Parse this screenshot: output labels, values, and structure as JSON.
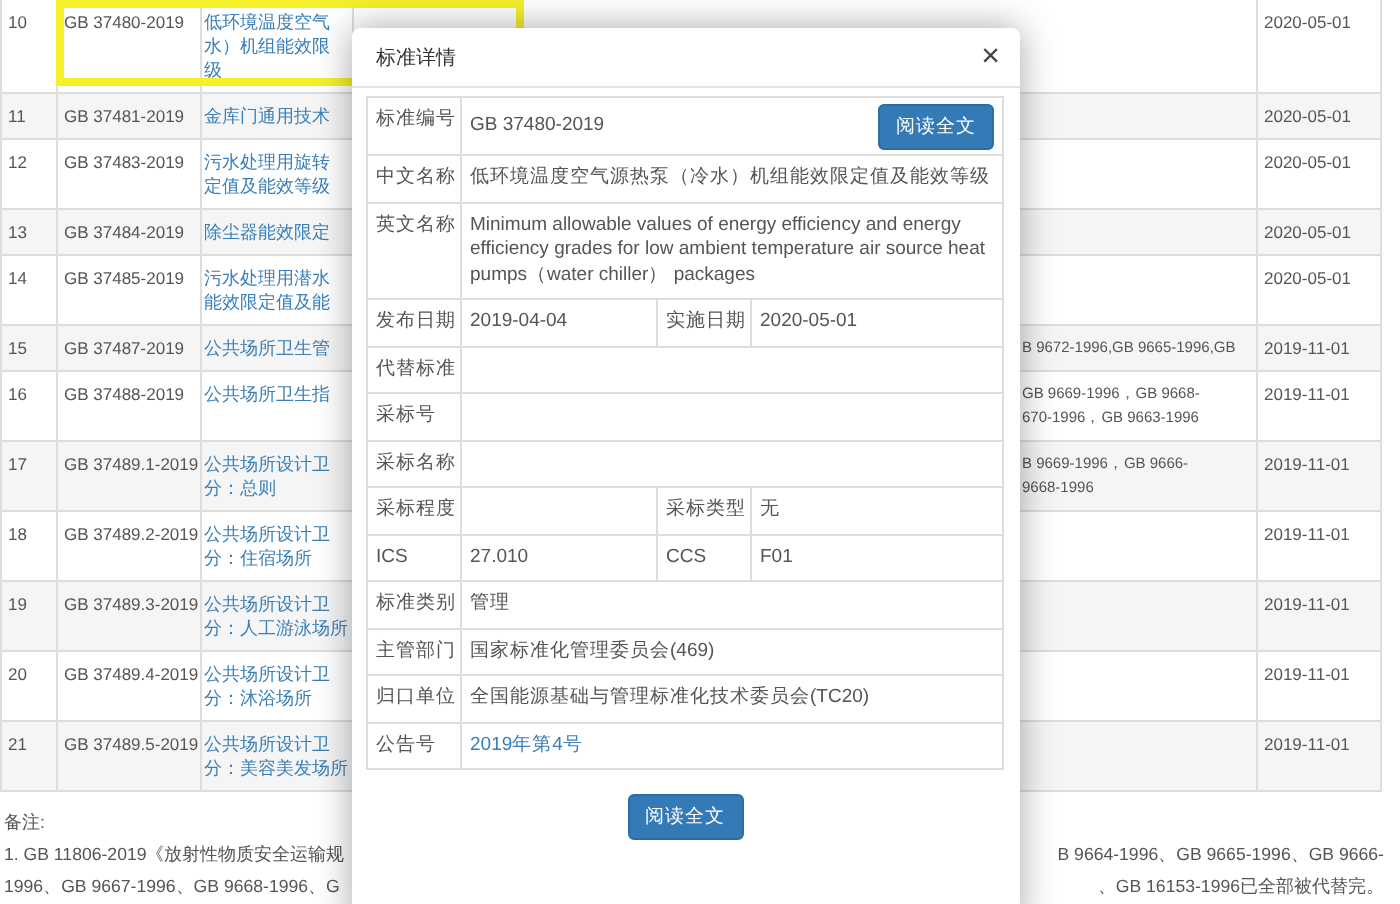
{
  "table": {
    "rows": [
      {
        "no": "10",
        "code": "GB 37480-2019",
        "name": [
          "低环境温度空气",
          "水）机组能效限",
          "级"
        ],
        "replaced": [],
        "date": "2020-05-01"
      },
      {
        "no": "11",
        "code": "GB 37481-2019",
        "name": [
          "金库门通用技术"
        ],
        "replaced": [],
        "date": "2020-05-01"
      },
      {
        "no": "12",
        "code": "GB 37483-2019",
        "name": [
          "污水处理用旋转",
          "定值及能效等级"
        ],
        "replaced": [],
        "date": "2020-05-01"
      },
      {
        "no": "13",
        "code": "GB 37484-2019",
        "name": [
          "除尘器能效限定"
        ],
        "replaced": [],
        "date": "2020-05-01"
      },
      {
        "no": "14",
        "code": "GB 37485-2019",
        "name": [
          "污水处理用潜水",
          "能效限定值及能"
        ],
        "replaced": [],
        "date": "2020-05-01"
      },
      {
        "no": "15",
        "code": "GB 37487-2019",
        "name": [
          "公共场所卫生管"
        ],
        "replaced": [
          "B 9672-1996,GB 9665-1996,GB"
        ],
        "date": "2019-11-01"
      },
      {
        "no": "16",
        "code": "GB 37488-2019",
        "name": [
          "公共场所卫生指"
        ],
        "replaced": [
          "GB 9669-1996，GB 9668-",
          "670-1996，GB 9663-1996"
        ],
        "date": "2019-11-01"
      },
      {
        "no": "17",
        "code": "GB 37489.1-2019",
        "name": [
          "公共场所设计卫",
          "分：总则"
        ],
        "replaced": [
          "B 9669-1996，GB 9666-",
          "9668-1996"
        ],
        "date": "2019-11-01"
      },
      {
        "no": "18",
        "code": "GB 37489.2-2019",
        "name": [
          "公共场所设计卫",
          "分：住宿场所"
        ],
        "replaced": [],
        "date": "2019-11-01"
      },
      {
        "no": "19",
        "code": "GB 37489.3-2019",
        "name": [
          "公共场所设计卫",
          "分：人工游泳场所"
        ],
        "replaced": [],
        "date": "2019-11-01"
      },
      {
        "no": "20",
        "code": "GB 37489.4-2019",
        "name": [
          "公共场所设计卫",
          "分：沐浴场所"
        ],
        "replaced": [],
        "date": "2019-11-01"
      },
      {
        "no": "21",
        "code": "GB 37489.5-2019",
        "name": [
          "公共场所设计卫",
          "分：美容美发场所"
        ],
        "replaced": [],
        "date": "2019-11-01"
      }
    ]
  },
  "notes": {
    "label": "备注:",
    "lines": [
      {
        "left": "1. GB 11806-2019《放射性物质安全运输规",
        "right": "B 9664-1996、GB 9665-1996、GB 9666-"
      },
      {
        "left": "1996、GB 9667-1996、GB 9668-1996、G",
        "right": "、GB 16153-1996已全部被代替完。"
      }
    ]
  },
  "dialog": {
    "title": "标准详情",
    "close": "×",
    "fields": [
      {
        "kind": "code",
        "label": "标准编号",
        "value": "GB 37480-2019",
        "button": "阅读全文"
      },
      {
        "kind": "text",
        "label": "中文名称",
        "value": "低环境温度空气源热泵（冷水）机组能效限定值及能效等级"
      },
      {
        "kind": "text",
        "label": "英文名称",
        "value": "Minimum allowable values of energy efficiency and energy efficiency grades for low ambient temperature air source heat pumps（water chiller） packages"
      },
      {
        "kind": "pair",
        "label": "发布日期",
        "value": "2019-04-04",
        "label2": "实施日期",
        "value2": "2020-05-01"
      },
      {
        "kind": "text",
        "label": "代替标准"
      },
      {
        "kind": "text",
        "label": "采标号"
      },
      {
        "kind": "text",
        "label": "采标名称"
      },
      {
        "kind": "pair",
        "label": "采标程度",
        "label2": "采标类型",
        "value2": "无"
      },
      {
        "kind": "pair",
        "label": "ICS",
        "value": "27.010",
        "label2": "CCS",
        "value2": "F01"
      },
      {
        "kind": "text",
        "label": "标准类别",
        "value": "管理"
      },
      {
        "kind": "text",
        "label": "主管部门",
        "value": "国家标准化管理委员会(469)"
      },
      {
        "kind": "text",
        "label": "归口单位",
        "value": "全国能源基础与管理标准化技术委员会(TC20)"
      },
      {
        "kind": "link",
        "label": "公告号",
        "value": "2019年第4号"
      }
    ],
    "footer_button": "阅读全文"
  }
}
